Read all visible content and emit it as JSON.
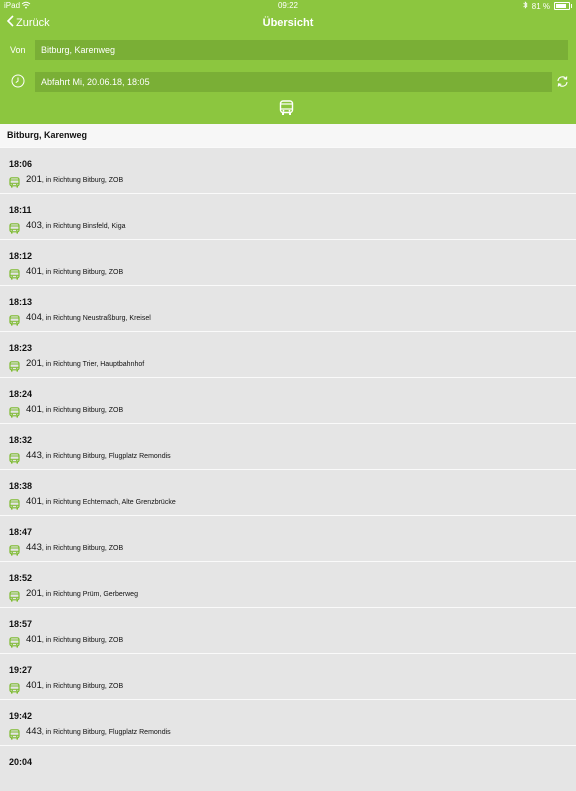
{
  "status": {
    "carrier": "iPad",
    "time": "09:22",
    "battery": "81 %",
    "battery_level": 0.81
  },
  "nav": {
    "back_label": "Zurück",
    "title": "Übersicht"
  },
  "form": {
    "from_label": "Von",
    "from_value": "Bitburg, Karenweg",
    "departure_value": "Abfahrt Mi, 20.06.18, 18:05"
  },
  "section_title": "Bitburg, Karenweg",
  "departures": [
    {
      "time": "18:06",
      "line": "201",
      "direction": ", in Richtung Bitburg, ZOB"
    },
    {
      "time": "18:11",
      "line": "403",
      "direction": ", in Richtung Binsfeld, Kiga"
    },
    {
      "time": "18:12",
      "line": "401",
      "direction": ", in Richtung Bitburg, ZOB"
    },
    {
      "time": "18:13",
      "line": "404",
      "direction": ", in Richtung Neustraßburg, Kreisel"
    },
    {
      "time": "18:23",
      "line": "201",
      "direction": ", in Richtung Trier, Hauptbahnhof"
    },
    {
      "time": "18:24",
      "line": "401",
      "direction": ", in Richtung Bitburg, ZOB"
    },
    {
      "time": "18:32",
      "line": "443",
      "direction": ", in Richtung Bitburg, Flugplatz Remondis"
    },
    {
      "time": "18:38",
      "line": "401",
      "direction": ", in Richtung Echternach, Alte Grenzbrücke"
    },
    {
      "time": "18:47",
      "line": "443",
      "direction": ", in Richtung Bitburg, ZOB"
    },
    {
      "time": "18:52",
      "line": "201",
      "direction": ", in Richtung Prüm, Gerberweg"
    },
    {
      "time": "18:57",
      "line": "401",
      "direction": ", in Richtung Bitburg, ZOB"
    },
    {
      "time": "19:27",
      "line": "401",
      "direction": ", in Richtung Bitburg, ZOB"
    },
    {
      "time": "19:42",
      "line": "443",
      "direction": ", in Richtung Bitburg, Flugplatz Remondis"
    },
    {
      "time": "20:04",
      "line": "",
      "direction": ""
    }
  ],
  "icons": {
    "wifi": "wifi-icon",
    "bluetooth": "bluetooth-icon",
    "battery": "battery-icon",
    "back": "chevron-left-icon",
    "clock": "clock-icon",
    "refresh": "refresh-icon",
    "bus": "bus-icon"
  },
  "colors": {
    "header": "#8cc63f",
    "input": "#7aaf36",
    "bus_icon": "#7cba2e",
    "list_bg": "#e5e5e5",
    "section_bg": "#f7f7f7"
  }
}
